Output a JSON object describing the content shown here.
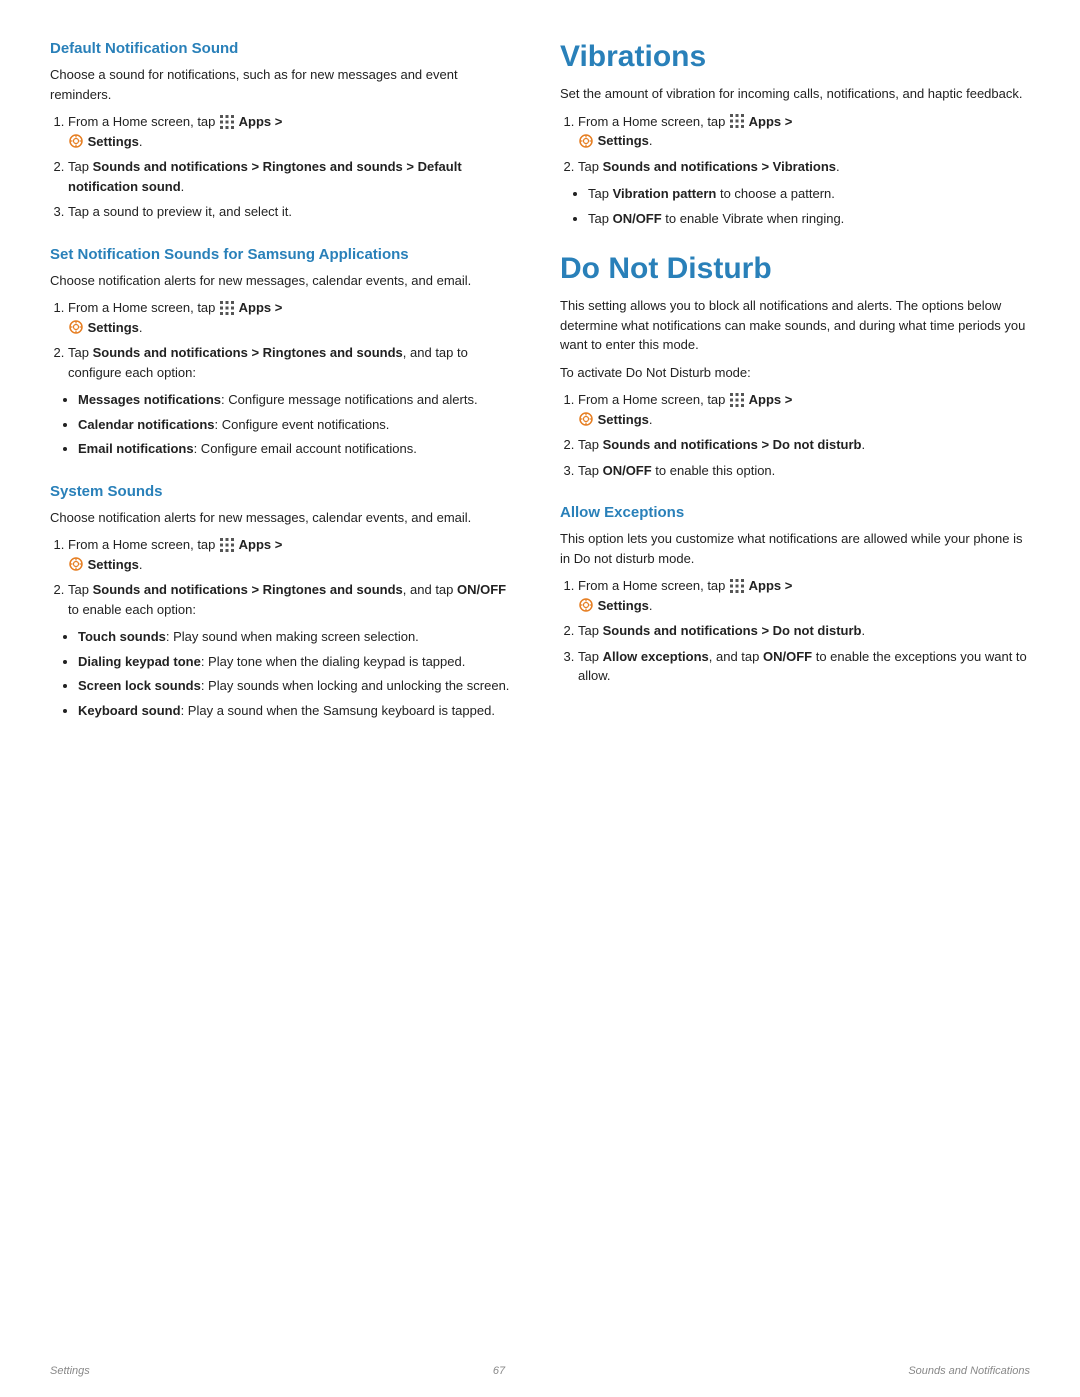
{
  "leftCol": {
    "section1": {
      "title": "Default Notification Sound",
      "intro": "Choose a sound for notifications, such as for new messages and event reminders.",
      "steps": [
        {
          "text": "From a Home screen, tap",
          "apps": "Apps >",
          "settings_icon": true,
          "settings": "Settings."
        },
        {
          "text": "Tap",
          "bold1": "Sounds and notifications > Ringtones and sounds > Default notification sound",
          "text2": "."
        },
        {
          "text": "Tap a sound to preview it, and select it."
        }
      ]
    },
    "section2": {
      "title": "Set Notification Sounds for Samsung Applications",
      "intro": "Choose notification alerts for new messages, calendar events, and email.",
      "steps": [
        {
          "text": "From a Home screen, tap",
          "apps": "Apps >",
          "settings_icon": true,
          "settings": "Settings."
        },
        {
          "text": "Tap",
          "bold1": "Sounds and notifications > Ringtones and sounds",
          "text2": ", and tap to configure each option:"
        }
      ],
      "bullets": [
        {
          "bold": "Messages notifications",
          "text": ": Configure message notifications and alerts."
        },
        {
          "bold": "Calendar notifications",
          "text": ": Configure event notifications."
        },
        {
          "bold": "Email notifications",
          "text": ": Configure email account notifications."
        }
      ]
    },
    "section3": {
      "title": "System Sounds",
      "intro": "Choose notification alerts for new messages, calendar events, and email.",
      "steps": [
        {
          "text": "From a Home screen, tap",
          "apps": "Apps >",
          "settings_icon": true,
          "settings": "Settings."
        },
        {
          "text": "Tap",
          "bold1": "Sounds and notifications > Ringtones and sounds",
          "text2": ", and tap",
          "bold2": "ON/OFF",
          "text3": " to enable each option:"
        }
      ],
      "bullets": [
        {
          "bold": "Touch sounds",
          "text": ": Play sound when making screen selection."
        },
        {
          "bold": "Dialing keypad tone",
          "text": ": Play tone when the dialing keypad is tapped."
        },
        {
          "bold": "Screen lock sounds",
          "text": ": Play sounds when locking and unlocking the screen."
        },
        {
          "bold": "Keyboard sound",
          "text": ": Play a sound when the Samsung keyboard is tapped."
        }
      ]
    }
  },
  "rightCol": {
    "section1": {
      "title": "Vibrations",
      "intro": "Set the amount of vibration for incoming calls, notifications, and haptic feedback.",
      "steps": [
        {
          "text": "From a Home screen, tap",
          "apps": "Apps >",
          "settings_icon": true,
          "settings": "Settings."
        },
        {
          "text": "Tap",
          "bold1": "Sounds and notifications > Vibrations",
          "text2": "."
        }
      ],
      "bullets": [
        {
          "bold": "Vibration pattern",
          "text": " to choose a pattern."
        },
        {
          "bold": "ON/OFF",
          "text": " to enable Vibrate when ringing.",
          "prefix": "Tap "
        }
      ],
      "bullet_prefix": "Tap"
    },
    "section2": {
      "title": "Do Not Disturb",
      "intro": "This setting allows you to block all notifications and alerts. The options below determine what notifications can make sounds, and during what time periods you want to enter this mode.",
      "activate_label": "To activate Do Not Disturb mode:",
      "steps": [
        {
          "text": "From a Home screen, tap",
          "apps": "Apps >",
          "settings_icon": true,
          "settings": "Settings."
        },
        {
          "text": "Tap",
          "bold1": "Sounds and notifications > Do not disturb",
          "text2": "."
        },
        {
          "text": "Tap",
          "bold1": "ON/OFF",
          "text2": " to enable this option."
        }
      ]
    },
    "section3": {
      "title": "Allow Exceptions",
      "intro": "This option lets you customize what notifications are allowed while your phone is in Do not disturb mode.",
      "steps": [
        {
          "text": "From a Home screen, tap",
          "apps": "Apps >",
          "settings_icon": true,
          "settings": "Settings."
        },
        {
          "text": "Tap",
          "bold1": "Sounds and notifications > Do not disturb",
          "text2": "."
        },
        {
          "text": "Tap",
          "bold1": "Allow exceptions",
          "text2": ", and tap",
          "bold2": "ON/OFF",
          "text3": " to enable the exceptions you want to allow."
        }
      ]
    }
  },
  "footer": {
    "left": "Settings",
    "center": "67",
    "right": "Sounds and Notifications"
  }
}
